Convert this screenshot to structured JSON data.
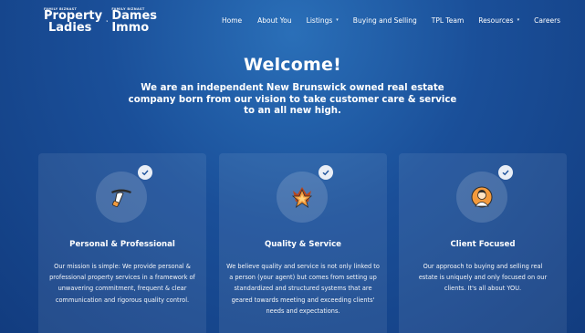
{
  "brand": {
    "left_tiny": "FAMILY BIZNAST",
    "left_line1": "Property",
    "left_line2": "Ladies",
    "right_tiny": "FAMILY BIZNAST",
    "right_line1": "Dames",
    "right_line2": "Immo",
    "icon": "house-logo-icon"
  },
  "nav": {
    "items": [
      {
        "label": "Home",
        "dropdown": false
      },
      {
        "label": "About You",
        "dropdown": false
      },
      {
        "label": "Listings",
        "dropdown": true
      },
      {
        "label": "Buying and Selling",
        "dropdown": false
      },
      {
        "label": "TPL Team",
        "dropdown": false
      },
      {
        "label": "Resources",
        "dropdown": true
      },
      {
        "label": "Careers",
        "dropdown": false
      }
    ],
    "caret_glyph": "▾"
  },
  "hero": {
    "title": "Welcome!",
    "subtitle": "We are an independent New Brunswick owned real estate company born from our vision to take customer care & service to an all new high."
  },
  "cards": [
    {
      "title": "Personal & Professional",
      "icon": "serving-tray-hand-icon",
      "body": "Our mission is simple: We provide personal & professional property services in a framework of unwavering commitment, frequent & clear communication and rigorous quality control."
    },
    {
      "title": "Quality & Service",
      "icon": "star-badge-icon",
      "body": "We believe quality and service is not only linked to a person (your agent) but comes from setting up standardized and structured systems that are geared towards meeting and exceeding clients' needs and expectations."
    },
    {
      "title": "Client Focused",
      "icon": "client-person-icon",
      "body": "Our approach to buying and selling real estate is uniquely and only focused on our clients. It's all about YOU."
    }
  ],
  "colors": {
    "background_top": "#2a6fb8",
    "background_bottom": "#123c7f",
    "icon_orange": "#f39a3d",
    "check_bg": "#e9eef6"
  }
}
